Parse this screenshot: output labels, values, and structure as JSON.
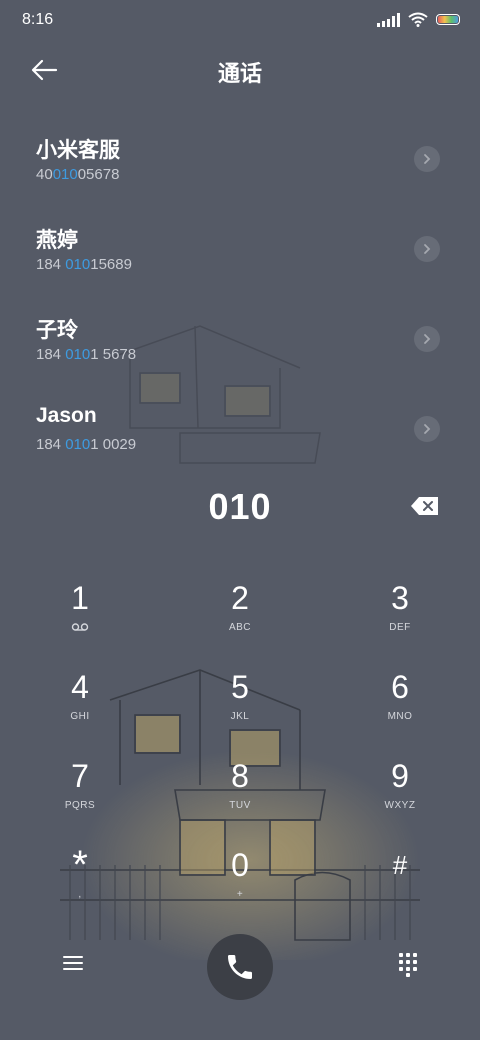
{
  "status_bar": {
    "time": "8:16"
  },
  "header": {
    "title": "通话"
  },
  "results": [
    {
      "name": "小米客服",
      "num_pre": "40",
      "num_match": "010",
      "num_post": "05678"
    },
    {
      "name": "燕婷",
      "num_pre": "184 ",
      "num_match": "010",
      "num_post": "15689"
    },
    {
      "name": "子玲",
      "num_pre": "184 ",
      "num_match": "010",
      "num_post": "1 5678"
    },
    {
      "name": "Jason",
      "num_pre": "184 ",
      "num_match": "010",
      "num_post": "1 0029"
    }
  ],
  "input": {
    "value": "010"
  },
  "keypad": [
    {
      "digit": "1",
      "letters": ""
    },
    {
      "digit": "2",
      "letters": "ABC"
    },
    {
      "digit": "3",
      "letters": "DEF"
    },
    {
      "digit": "4",
      "letters": "GHI"
    },
    {
      "digit": "5",
      "letters": "JKL"
    },
    {
      "digit": "6",
      "letters": "MNO"
    },
    {
      "digit": "7",
      "letters": "PQRS"
    },
    {
      "digit": "8",
      "letters": "TUV"
    },
    {
      "digit": "9",
      "letters": "WXYZ"
    },
    {
      "digit": "*",
      "letters": ","
    },
    {
      "digit": "0",
      "letters": "+"
    },
    {
      "digit": "#",
      "letters": ""
    }
  ],
  "icons": {
    "back": "arrow-left-icon",
    "row_arrow": "chevron-right-icon",
    "delete": "backspace-icon",
    "voicemail": "voicemail-icon",
    "menu": "menu-icon",
    "call": "phone-icon",
    "dialpad": "dialpad-icon"
  },
  "colors": {
    "background": "#555a66",
    "match_highlight": "#3e9be0",
    "call_button": "#3c3f46"
  }
}
